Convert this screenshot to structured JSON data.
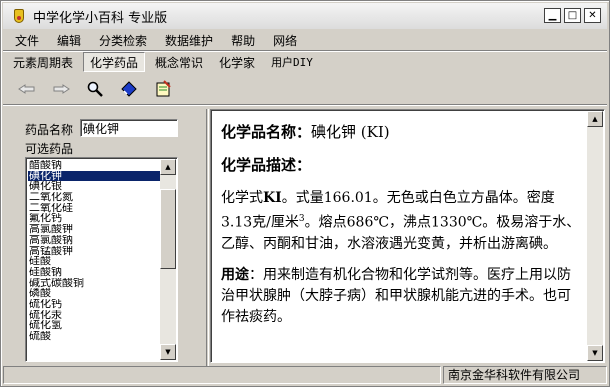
{
  "window": {
    "title": "中学化学小百科 专业版"
  },
  "menu": [
    "文件",
    "编辑",
    "分类检索",
    "数据维护",
    "帮助",
    "网络"
  ],
  "tabs": [
    "元素周期表",
    "化学药品",
    "概念常识",
    "化学家",
    "用户DIY"
  ],
  "active_tab": "化学药品",
  "toolbar": [
    {
      "name": "back-hand-icon"
    },
    {
      "name": "forward-hand-icon"
    },
    {
      "name": "search-icon"
    },
    {
      "name": "eraser-icon"
    },
    {
      "name": "notes-icon"
    }
  ],
  "left": {
    "name_label": "药品名称",
    "name_value": "碘化钾",
    "list_label": "可选药品",
    "items": [
      "醋酸钠",
      "碘化钾",
      "碘化银",
      "二氧化氮",
      "二氧化硅",
      "氟化钙",
      "高氯酸钾",
      "高氯酸钠",
      "高锰酸钾",
      "硅酸",
      "硅酸钠",
      "碱式碳酸铜",
      "磷酸",
      "硫化钙",
      "硫化汞",
      "硫化氢",
      "硫酸"
    ],
    "selected_index": 1
  },
  "content": {
    "name_heading": "化学品名称：",
    "name_value": "碘化钾 (KI)",
    "desc_heading": "化学品描述：",
    "formula_label": "化学式",
    "formula": "KI",
    "mass_text": "。式量166.01。无色或白色立方晶体。密度3.13克/厘米",
    "density_exp": "3",
    "props_text": "。熔点686℃，沸点1330℃。极易溶于水、乙醇、丙酮和甘油，水溶液遇光变黄，并析出游离碘。",
    "use_heading": "用途",
    "use_text": "：用来制造有机化合物和化学试剂等。医疗上用以防治甲状腺肿（大脖子病）和甲状腺机能亢进的手术。也可作祛痰药。"
  },
  "status": {
    "company": "南京金华科软件有限公司"
  }
}
